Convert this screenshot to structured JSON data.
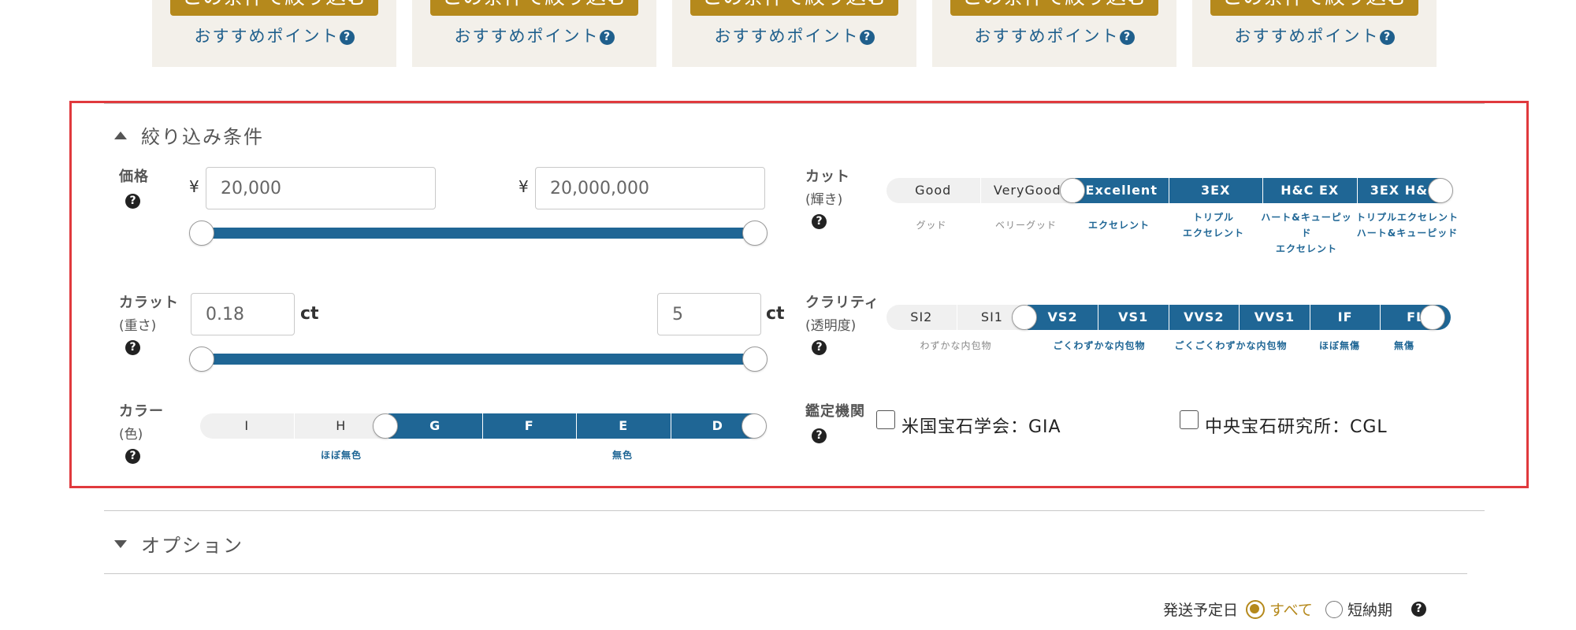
{
  "cards": [
    {
      "button_label": "この条件で絞り込む",
      "link_label": "おすすめポイント"
    },
    {
      "button_label": "この条件で絞り込む",
      "link_label": "おすすめポイント"
    },
    {
      "button_label": "この条件で絞り込む",
      "link_label": "おすすめポイント"
    },
    {
      "button_label": "この条件で絞り込む",
      "link_label": "おすすめポイント"
    },
    {
      "button_label": "この条件で絞り込む",
      "link_label": "おすすめポイント"
    }
  ],
  "help_icon": "?",
  "filters": {
    "title": "絞り込み条件",
    "price": {
      "label": "価格",
      "currency": "¥",
      "min_value": "20,000",
      "max_value": "20,000,000"
    },
    "carat": {
      "label": "カラット",
      "sublabel": "(重さ)",
      "min_value": "0.18",
      "max_value": "5",
      "unit": "ct"
    },
    "color": {
      "label": "カラー",
      "sublabel": "(色)",
      "grades": [
        "I",
        "H",
        "G",
        "F",
        "E",
        "D"
      ],
      "selected_from": "G",
      "selected_to": "D",
      "groups": [
        "ほぼ無色",
        "無色"
      ]
    },
    "cut": {
      "label": "カット",
      "sublabel": "(輝き)",
      "grades": [
        "Good",
        "VeryGood",
        "Excellent",
        "3EX",
        "H&C EX",
        "3EX H&C"
      ],
      "selected_from": "Excellent",
      "selected_to": "3EX H&C",
      "descriptions": [
        {
          "line1": "グッド",
          "line2": ""
        },
        {
          "line1": "ベリーグッド",
          "line2": ""
        },
        {
          "line1": "エクセレント",
          "line2": ""
        },
        {
          "line1": "トリプル",
          "line2": "エクセレント"
        },
        {
          "line1": "ハート&キューピッド",
          "line2": "エクセレント"
        },
        {
          "line1": "トリプルエクセレント",
          "line2": "ハート&キューピッド"
        }
      ]
    },
    "clarity": {
      "label": "クラリティ",
      "sublabel": "(透明度)",
      "grades": [
        "SI2",
        "SI1",
        "VS2",
        "VS1",
        "VVS2",
        "VVS1",
        "IF",
        "FL"
      ],
      "selected_from": "VS2",
      "selected_to": "FL",
      "groups": [
        "わずかな内包物",
        "ごくわずかな内包物",
        "ごくごくわずかな内包物",
        "ほぼ無傷",
        "無傷"
      ]
    },
    "lab": {
      "label": "鑑定機関",
      "options": [
        {
          "label": "米国宝石学会：GIA",
          "checked": false
        },
        {
          "label": "中央宝石研究所：CGL",
          "checked": false
        }
      ]
    }
  },
  "options_section": {
    "title": "オプション"
  },
  "shipping": {
    "label": "発送予定日",
    "options": [
      {
        "label": "すべて",
        "selected": true
      },
      {
        "label": "短納期",
        "selected": false
      }
    ]
  }
}
